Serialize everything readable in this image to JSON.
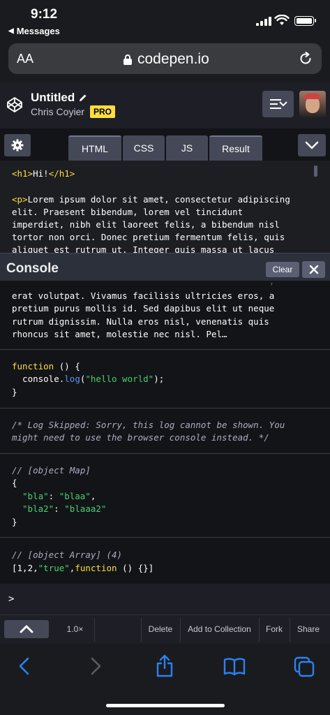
{
  "status": {
    "time": "9:12",
    "back_label": "Messages"
  },
  "browser": {
    "text_size_label": "AA",
    "url": "codepen.io"
  },
  "pen": {
    "title": "Untitled",
    "author": "Chris Coyier",
    "badge": "PRO"
  },
  "tabs": [
    {
      "label": "HTML"
    },
    {
      "label": "CSS"
    },
    {
      "label": "JS"
    },
    {
      "label": "Result"
    }
  ],
  "editor": {
    "line1_open": "<h1>",
    "line1_text": "Hi!",
    "line1_close": "</h1>",
    "p_open": "<p>",
    "p_lines": [
      "Lorem ipsum dolor sit amet, consectetur adipiscing",
      "elit. Praesent bibendum, lorem vel tincidunt",
      "imperdiet, nibh elit laoreet felis, a bibendum nisl",
      "tortor non orci. Donec pretium fermentum felis, quis",
      "aliquet est rutrum ut. Integer quis massa ut lacus"
    ]
  },
  "console": {
    "title": "Console",
    "clear_label": "Clear",
    "entries": {
      "lorem": [
        "erat volutpat. Vivamus facilisis ultricies eros, a",
        "pretium purus mollis id. Sed dapibus elit ut neque",
        "rutrum dignissim. Nulla eros nisl, venenatis quis",
        "rhoncus sit amet, molestie nec nisl. Pel…"
      ],
      "fn": {
        "kw": "function",
        "sig": " () {",
        "obj": "  console.",
        "method": "log",
        "open": "(",
        "arg": "\"hello world\"",
        "close": ");",
        "end": "}"
      },
      "skipped": [
        "/* Log Skipped: Sorry, this log cannot be shown. You",
        "might need to use the browser console instead. */"
      ],
      "map": {
        "comment": "// [object Map]",
        "open": "{",
        "k1": "\"bla\"",
        "v1": "\"blaa\"",
        "k2": "\"bla2\"",
        "v2": "\"blaaa2\"",
        "sep": ": ",
        "comma": ",",
        "close": "}"
      },
      "array": {
        "comment": "// [object Array] (4)",
        "pre": "[1,2,",
        "str": "\"true\"",
        "comma": ",",
        "kw": "function",
        "post": " () {}]"
      }
    },
    "prompt": ">"
  },
  "footer": {
    "zoom": "1.0×",
    "delete": "Delete",
    "add_to_collection": "Add to Collection",
    "fork": "Fork",
    "share": "Share"
  },
  "colors": {
    "pro_badge": "#ffdd40",
    "accent_blue": "#2a82f5",
    "string_green": "#47cf73"
  }
}
